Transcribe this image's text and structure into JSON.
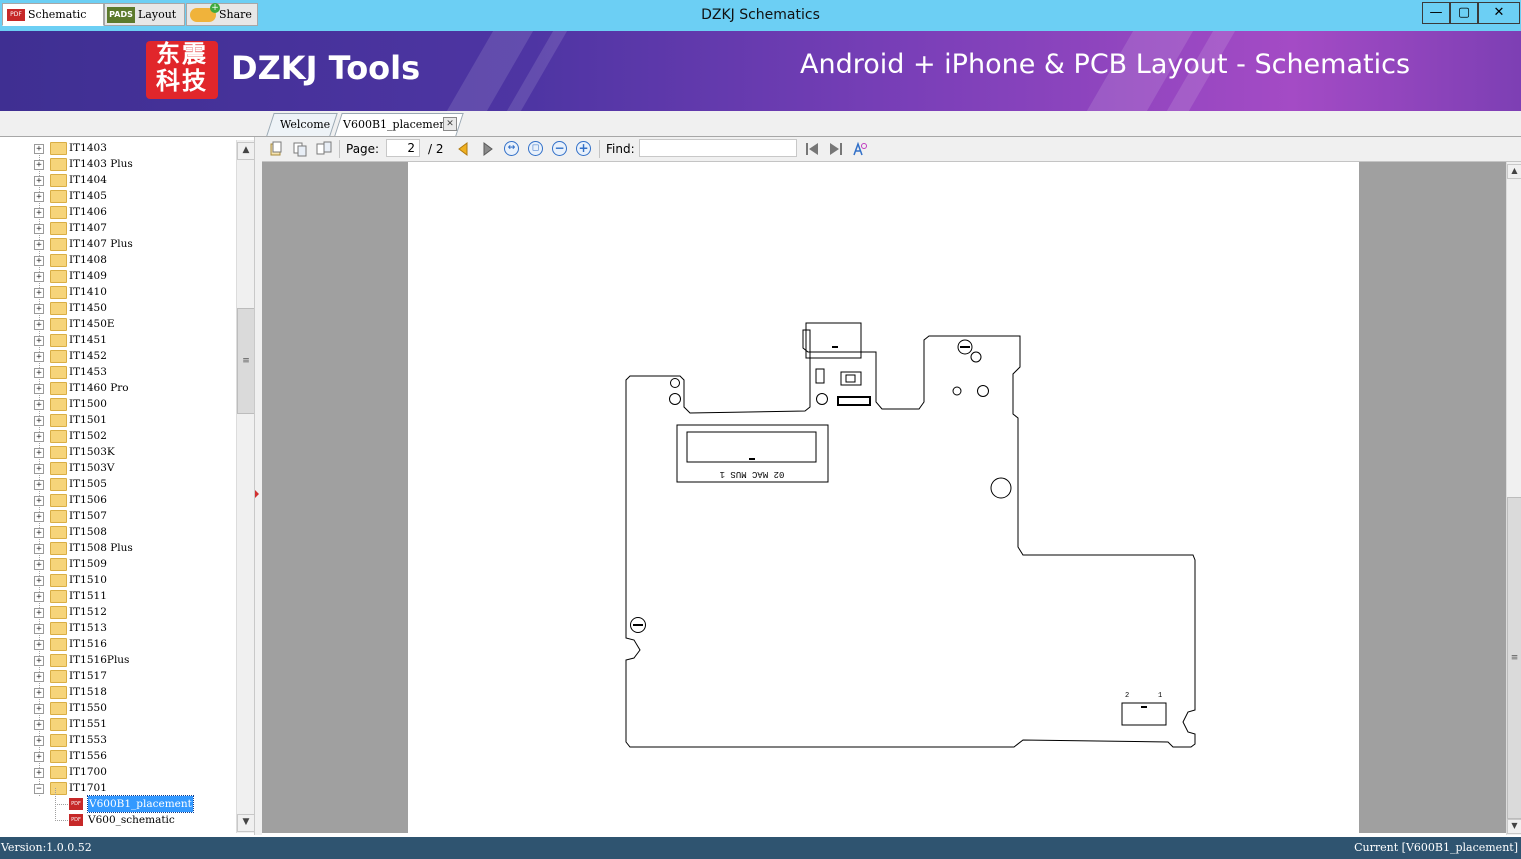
{
  "window": {
    "title": "DZKJ Schematics",
    "controls": {
      "minimize": "—",
      "maximize": "▢",
      "close": "✕"
    }
  },
  "banner": {
    "logo_chars": [
      "东",
      "震",
      "科",
      "技"
    ],
    "logo_text": "DZKJ Tools",
    "slogan": "Android + iPhone & PCB Layout - Schematics"
  },
  "left_tabs": [
    {
      "label": "Schematic",
      "icon": "pdf-icon",
      "active": true
    },
    {
      "label": "Layout",
      "icon": "pads-icon",
      "active": false
    },
    {
      "label": "Share",
      "icon": "share-cloud-icon",
      "active": false
    }
  ],
  "icon_text": {
    "pdf": "PDF",
    "pads": "PADS"
  },
  "doc_tabs": [
    {
      "label": "Welcome",
      "active": false
    },
    {
      "label": "V600B1_placement",
      "active": true,
      "close": "✕"
    }
  ],
  "tree": {
    "folders": [
      "IT1403",
      "IT1403 Plus",
      "IT1404",
      "IT1405",
      "IT1406",
      "IT1407",
      "IT1407 Plus",
      "IT1408",
      "IT1409",
      "IT1410",
      "IT1450",
      "IT1450E",
      "IT1451",
      "IT1452",
      "IT1453",
      "IT1460 Pro",
      "IT1500",
      "IT1501",
      "IT1502",
      "IT1503K",
      "IT1503V",
      "IT1505",
      "IT1506",
      "IT1507",
      "IT1508",
      "IT1508 Plus",
      "IT1509",
      "IT1510",
      "IT1511",
      "IT1512",
      "IT1513",
      "IT1516",
      "IT1516Plus",
      "IT1517",
      "IT1518",
      "IT1550",
      "IT1551",
      "IT1553",
      "IT1556",
      "IT1700"
    ],
    "expanded_folder": "IT1701",
    "files": [
      {
        "label": "V600B1_placement",
        "selected": true
      },
      {
        "label": "V600_schematic",
        "selected": false
      }
    ],
    "expand_symbol": "+",
    "collapse_symbol": "−"
  },
  "toolbar": {
    "page_label": "Page:",
    "page_current": "2",
    "page_total": "/ 2",
    "find_label": "Find:",
    "find_value": ""
  },
  "document": {
    "connector_label": "02  MAC MUS  1",
    "pin_labels": [
      "1",
      "2"
    ]
  },
  "status": {
    "version": "Version:1.0.0.52",
    "current": "Current [V600B1_placement]"
  },
  "colors": {
    "titlebar": "#6ccff4",
    "statusbar": "#2f5470",
    "selection": "#3399ff",
    "viewer_background": "#a0a0a0"
  }
}
